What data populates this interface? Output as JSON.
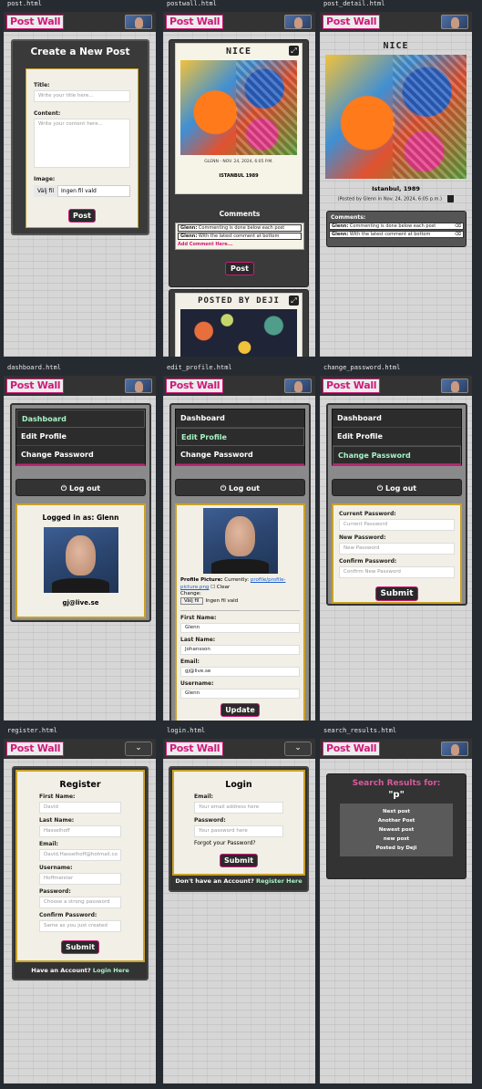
{
  "brand": "Post Wall",
  "captions": {
    "post": "post.html",
    "postwall": "postwall.html",
    "post_detail": "post_detail.html",
    "dashboard": "dashboard.html",
    "edit_profile": "edit_profile.html",
    "change_password": "change_password.html",
    "register": "register.html",
    "login": "login.html",
    "search_results": "search_results.html"
  },
  "create_post": {
    "heading": "Create a New Post",
    "title_label": "Title:",
    "title_placeholder": "Write your title here...",
    "content_label": "Content:",
    "content_placeholder": "Write your content here...",
    "image_label": "Image:",
    "file_button": "Välj fil",
    "file_status": "Ingen fil vald",
    "submit": "Post"
  },
  "postwall": {
    "post1_title": "NICE",
    "post1_meta": "GLENN - NOV. 24, 2024, 6:05 P.M.",
    "post1_caption": "ISTANBUL 1989",
    "comments_heading": "Comments",
    "comments": [
      {
        "author": "Glenn:",
        "text": "Commenting is done below each post"
      },
      {
        "author": "Glenn:",
        "text": "With the latest comment at bottom"
      }
    ],
    "add_comment": "Add Comment Here...",
    "post_button": "Post",
    "post2_title": "POSTED BY DEJI"
  },
  "post_detail": {
    "title": "NICE",
    "caption": "Istanbul, 1989",
    "meta": "(Posted by Glenn in Nov. 24, 2024, 6:05 p.m.)",
    "comments_heading": "Comments:",
    "comments": [
      {
        "author": "Glenn:",
        "text": "Commenting is done below each post"
      },
      {
        "author": "Glenn:",
        "text": "With the latest comment at bottom"
      }
    ]
  },
  "nav": {
    "dashboard": "Dashboard",
    "edit_profile": "Edit Profile",
    "change_password": "Change Password",
    "logout": "Log out"
  },
  "dashboard": {
    "logged_in": "Logged in as: Glenn",
    "email": "gj@live.se"
  },
  "edit_profile": {
    "picture_label": "Profile Picture:",
    "currently": "Currently:",
    "picture_link": "profile/profile-picture.png",
    "clear": "Clear",
    "change": "Change:",
    "file_button": "Välj fil",
    "file_status": "Ingen fil vald",
    "first_name_label": "First Name:",
    "first_name": "Glenn",
    "last_name_label": "Last Name:",
    "last_name": "Johansson",
    "email_label": "Email:",
    "email": "gj@live.se",
    "username_label": "Username:",
    "username": "Glenn",
    "update": "Update"
  },
  "change_password": {
    "current_label": "Current Password:",
    "current_placeholder": "Current Password",
    "new_label": "New Password:",
    "new_placeholder": "New Password",
    "confirm_label": "Confirm Password:",
    "confirm_placeholder": "Confirm New Password",
    "submit": "Submit"
  },
  "register": {
    "heading": "Register",
    "first_name_label": "First Name:",
    "first_name": "David",
    "last_name_label": "Last Name:",
    "last_name": "Hasselhoff",
    "email_label": "Email:",
    "email": "David.Hasselhoff@hotmail.co",
    "username_label": "Username:",
    "username": "Hoffmeister",
    "password_label": "Password:",
    "password_placeholder": "Choose a strong password",
    "confirm_label": "Confirm Password:",
    "confirm_placeholder": "Same as you just created",
    "submit": "Submit",
    "have_account": "Have an Account?",
    "login_link": "Login Here"
  },
  "login": {
    "heading": "Login",
    "email_label": "Email:",
    "email_placeholder": "Your email address here",
    "password_label": "Password:",
    "password_placeholder": "Your password here",
    "forgot": "Forgot your Password?",
    "submit": "Submit",
    "no_account": "Don't have an Account?",
    "register_link": "Register Here"
  },
  "search": {
    "heading": "Search Results for:",
    "query": "\"p\"",
    "results": [
      "Next post",
      "Another Post",
      "Newest post",
      "new post",
      "Posted by Deji"
    ]
  },
  "colors": {
    "brand_pink": "#d01a7a",
    "accent_green": "#a6f4c5",
    "header_bg": "#333333",
    "page_bg": "#262b31"
  },
  "icons": [
    "expand-icon",
    "trash-icon",
    "power-icon",
    "chevron-down-icon",
    "avatar-icon"
  ]
}
